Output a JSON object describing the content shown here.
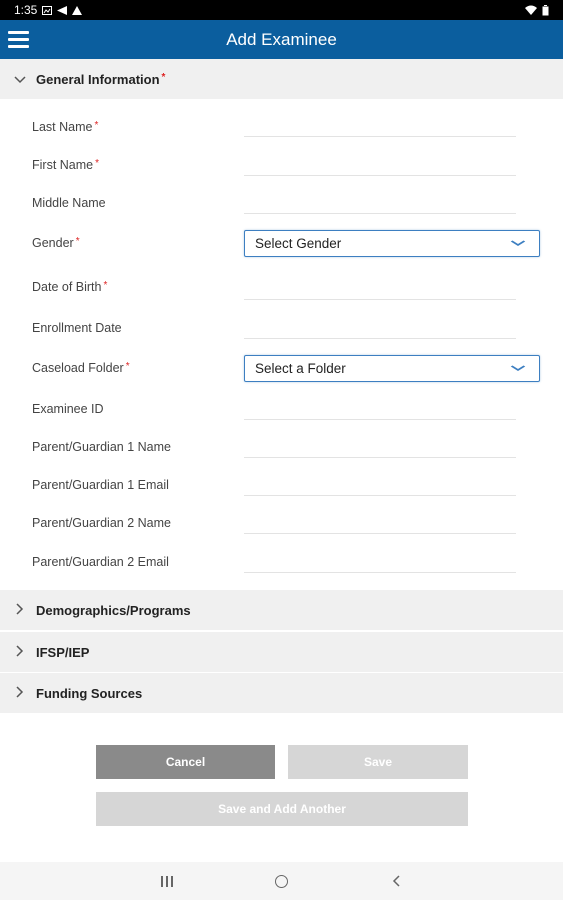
{
  "status_bar": {
    "time": "1:35"
  },
  "app_bar": {
    "title": "Add Examinee"
  },
  "sections": {
    "general": {
      "label": "General Information",
      "required_mark": "*"
    },
    "demographics": {
      "label": "Demographics/Programs"
    },
    "ifsp": {
      "label": "IFSP/IEP"
    },
    "funding": {
      "label": "Funding Sources"
    }
  },
  "fields": {
    "last_name": {
      "label": "Last Name",
      "required_mark": "*",
      "value": ""
    },
    "first_name": {
      "label": "First Name",
      "required_mark": "*",
      "value": ""
    },
    "middle_name": {
      "label": "Middle Name",
      "value": ""
    },
    "gender": {
      "label": "Gender",
      "required_mark": "*",
      "selected": "Select Gender"
    },
    "dob": {
      "label": "Date of Birth",
      "required_mark": "*",
      "value": ""
    },
    "enrollment_date": {
      "label": "Enrollment Date",
      "value": ""
    },
    "caseload_folder": {
      "label": "Caseload Folder",
      "required_mark": "*",
      "selected": "Select a Folder"
    },
    "examinee_id": {
      "label": "Examinee ID",
      "value": ""
    },
    "parent1_name": {
      "label": "Parent/Guardian 1 Name",
      "value": ""
    },
    "parent1_email": {
      "label": "Parent/Guardian 1 Email",
      "value": ""
    },
    "parent2_name": {
      "label": "Parent/Guardian 2 Name",
      "value": ""
    },
    "parent2_email": {
      "label": "Parent/Guardian 2 Email",
      "value": ""
    }
  },
  "buttons": {
    "cancel": "Cancel",
    "save": "Save",
    "save_and_add": "Save and Add Another"
  },
  "colors": {
    "app_bar": "#0b5e9e",
    "required": "#dd2222",
    "select_border": "#3d7fc1",
    "cancel_button": "#8a8a8a",
    "disabled_button": "#d6d6d6",
    "section_header": "#f0f0f0"
  },
  "icons": {
    "menu": "hamburger-icon",
    "expanded": "chevron-down-icon",
    "collapsed": "chevron-right-icon",
    "dropdown": "chevron-down-icon"
  }
}
